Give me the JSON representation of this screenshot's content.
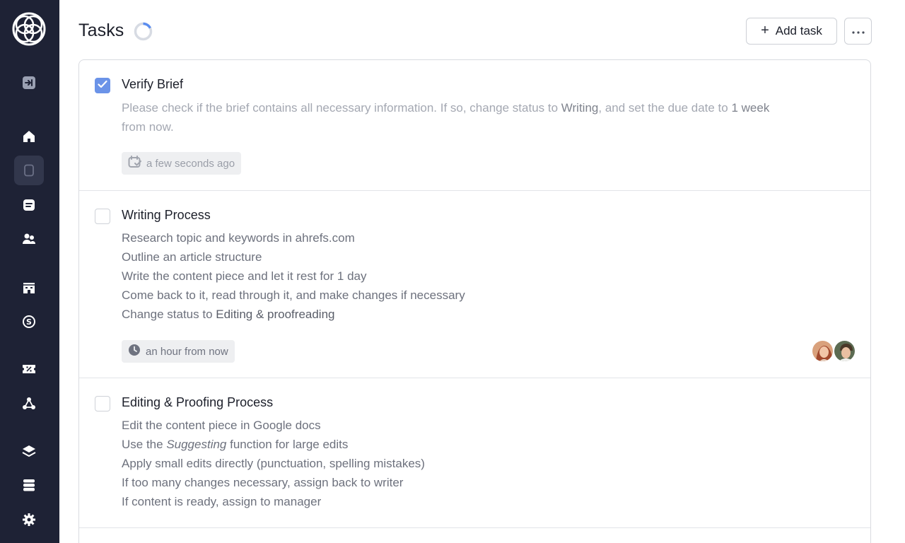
{
  "page": {
    "title": "Tasks",
    "loading_icon": "spinner-icon"
  },
  "toolbar": {
    "add_task_label": "Add task",
    "add_icon": "plus-icon",
    "more_icon": "ellipsis-icon"
  },
  "sidebar": {
    "logo": "app-logo",
    "items": [
      {
        "icon": "expand-panel-icon",
        "active": false
      },
      {
        "icon": "home-icon",
        "active": false
      },
      {
        "icon": "document-icon",
        "active": true
      },
      {
        "icon": "message-icon",
        "active": false
      },
      {
        "icon": "users-icon",
        "active": false
      },
      {
        "icon": "building-icon",
        "active": false
      },
      {
        "icon": "money-icon",
        "active": false
      },
      {
        "icon": "discount-ticket-icon",
        "active": false
      },
      {
        "icon": "integrations-icon",
        "active": false
      },
      {
        "icon": "layers-icon",
        "active": false
      },
      {
        "icon": "database-icon",
        "active": false
      },
      {
        "icon": "settings-icon",
        "active": false
      }
    ]
  },
  "colors": {
    "sidebar_bg": "#1e2235",
    "checkbox_checked": "#6b93e8",
    "spinner_accent": "#5b8def"
  },
  "tasks": [
    {
      "title": "Verify Brief",
      "completed": true,
      "description": {
        "part1": "Please check if the brief contains all necessary information. If so, change status to ",
        "status": "Writing",
        "part2": ", and set the due date to ",
        "due": "1 week",
        "part3": "from now."
      },
      "due_badge": {
        "icon": "calendar-check-icon",
        "text": "a few seconds ago"
      }
    },
    {
      "title": "Writing Process",
      "completed": false,
      "lines": [
        "Research topic and keywords in ahrefs.com",
        "Outline an article structure",
        "Write the content piece and let it rest for 1 day",
        "Come back to it, read through it, and make changes if necessary"
      ],
      "last_line_prefix": "Change status to ",
      "last_line_status": "Editing & proofreading",
      "due_badge": {
        "icon": "clock-icon",
        "text": "an hour from now"
      },
      "assignees": [
        "avatar-woman",
        "avatar-man"
      ]
    },
    {
      "title": "Editing & Proofing Process",
      "completed": false,
      "line1_prefix": "Edit the content piece in Google docs",
      "line2_prefix": "Use the ",
      "line2_emphasis": "Suggesting",
      "line2_suffix": " function for large edits",
      "lines_rest": [
        "Apply small edits directly (punctuation, spelling mistakes)",
        "If too many changes necessary, assign back to writer",
        "If content is ready, assign to manager"
      ]
    }
  ]
}
